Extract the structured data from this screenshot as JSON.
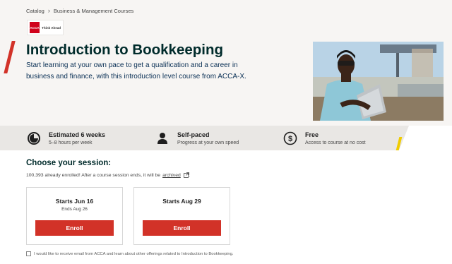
{
  "breadcrumb": {
    "items": [
      "Catalog",
      "Business & Management Courses"
    ]
  },
  "logo": {
    "mark": "ACCA",
    "tagline": "Think Ahead"
  },
  "course": {
    "title": "Introduction to Bookkeeping",
    "subtitle": "Start learning at your own pace to get a qualification and a career in business and finance, with this introduction level course from ACCA-X."
  },
  "features": [
    {
      "icon": "clock-icon",
      "heading": "Estimated 6 weeks",
      "detail": "5–8 hours per week"
    },
    {
      "icon": "person-icon",
      "heading": "Self-paced",
      "detail": "Progress at your own speed"
    },
    {
      "icon": "dollar-icon",
      "heading": "Free",
      "detail": "Access to course at no cost"
    }
  ],
  "session": {
    "title": "Choose your session:",
    "enroll_text": "100,393 already enrolled! After a course session ends, it will be",
    "archived_link": "archived",
    "cards": [
      {
        "start": "Starts Jun 16",
        "end": "Ends Aug 26",
        "button": "Enroll"
      },
      {
        "start": "Starts Aug 29",
        "end": "",
        "button": "Enroll"
      }
    ]
  },
  "consent": {
    "label": "I would like to receive email from ACCA and learn about other offerings related to Introduction to Bookkeeping."
  },
  "colors": {
    "brand_red": "#d23228",
    "heading": "#002b2b",
    "accent_yellow": "#f0cc00",
    "band": "#e9e7e4",
    "hero_bg": "#f7f5f3"
  }
}
